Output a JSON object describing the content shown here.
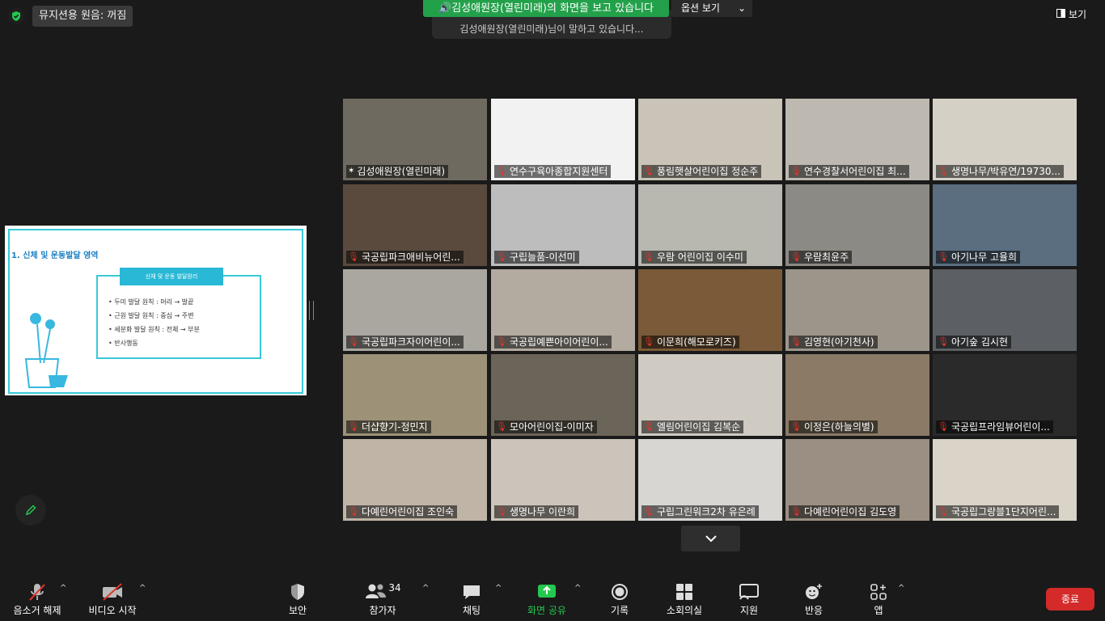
{
  "top": {
    "audio_pill": "뮤지션용 원음: 꺼짐",
    "share_banner": "김성애원장(열린미래)의 화면을 보고 있습니다",
    "share_sub": "김성애원장(열린미래)님이 말하고 있습니다...",
    "options": "옵션 보기",
    "view": "보기"
  },
  "slide": {
    "title": "1. 신체 및 운동발달 영역",
    "header": "신체 및 운동 발달원리",
    "items": [
      "• 두미 발달 원칙 : 머리 → 발끝",
      "• 근원 발달 원칙 : 중심 → 주변",
      "• 세분화 발달 원칙 : 전체 → 부분",
      "• 반사행동"
    ]
  },
  "participants": [
    {
      "name": "김성애원장(열린미래)",
      "active": true,
      "muted": false,
      "bg": "#6f6a60"
    },
    {
      "name": "연수구육아종합지원센터",
      "muted": true,
      "bg": "#f2f2f2"
    },
    {
      "name": "풍림햇살어린이집 정순주",
      "muted": true,
      "bg": "#c9c3b8"
    },
    {
      "name": "연수경찰서어린이집 최...",
      "muted": true,
      "bg": "#bdb8b0"
    },
    {
      "name": "생명나무/박유연/19730...",
      "muted": true,
      "bg": "#d5d0c5"
    },
    {
      "name": "국공립파크애비뉴어린...",
      "muted": true,
      "bg": "#5a4a3e"
    },
    {
      "name": "구립늘품-이선미",
      "muted": true,
      "bg": "#bdbdbd"
    },
    {
      "name": "우람 어린이집 이수미",
      "muted": true,
      "bg": "#b8b8b0"
    },
    {
      "name": "우람최윤주",
      "muted": true,
      "bg": "#8c8a84"
    },
    {
      "name": "아기나무 고율희",
      "muted": true,
      "bg": "#5a6e80"
    },
    {
      "name": "국공립파크자이어린이...",
      "muted": true,
      "bg": "#a9a79f"
    },
    {
      "name": "국공립예쁜아이어린이...",
      "muted": true,
      "bg": "#b3aaa0"
    },
    {
      "name": "이문희(해모로키즈)",
      "muted": true,
      "bg": "#7a5a38"
    },
    {
      "name": "김영현(아기천사)",
      "muted": true,
      "bg": "#9c958a"
    },
    {
      "name": "아기숲 김시현",
      "muted": true,
      "bg": "#5c6064"
    },
    {
      "name": "더샵향기-정민지",
      "muted": true,
      "bg": "#9d9278"
    },
    {
      "name": "모아어린이집-이미자",
      "muted": true,
      "bg": "#6b6458"
    },
    {
      "name": "엘림어린이집 김복순",
      "muted": true,
      "bg": "#cfcac2"
    },
    {
      "name": "이정은(하늘의별)",
      "muted": true,
      "bg": "#8b7a66"
    },
    {
      "name": "국공립프라임뷰어린이...",
      "muted": true,
      "bg": "#2a2a2a"
    },
    {
      "name": "다예린어린이집 조인숙",
      "muted": true,
      "bg": "#bfb4a6"
    },
    {
      "name": "생명나무 이란희",
      "muted": true,
      "bg": "#ccc4bb"
    },
    {
      "name": "구립그린워크2차 유은례",
      "muted": true,
      "bg": "#d8d6d2"
    },
    {
      "name": "다예린어린이집 김도영",
      "muted": true,
      "bg": "#9a8f82"
    },
    {
      "name": "국공립그랑블1단지어린...",
      "muted": true,
      "bg": "#d9d3c8"
    }
  ],
  "toolbar": {
    "unmute": "음소거 해제",
    "video": "비디오 시작",
    "security": "보안",
    "participants": "참가자",
    "participant_count": "34",
    "chat": "채팅",
    "share": "화면 공유",
    "record": "기록",
    "breakout": "소회의실",
    "support": "지원",
    "reactions": "반응",
    "apps": "앱",
    "end": "종료"
  },
  "colors": {
    "share_green": "#23a14a",
    "active_border": "#c9e84b",
    "end_red": "#d42a2a",
    "muted_red": "#e0352b"
  }
}
